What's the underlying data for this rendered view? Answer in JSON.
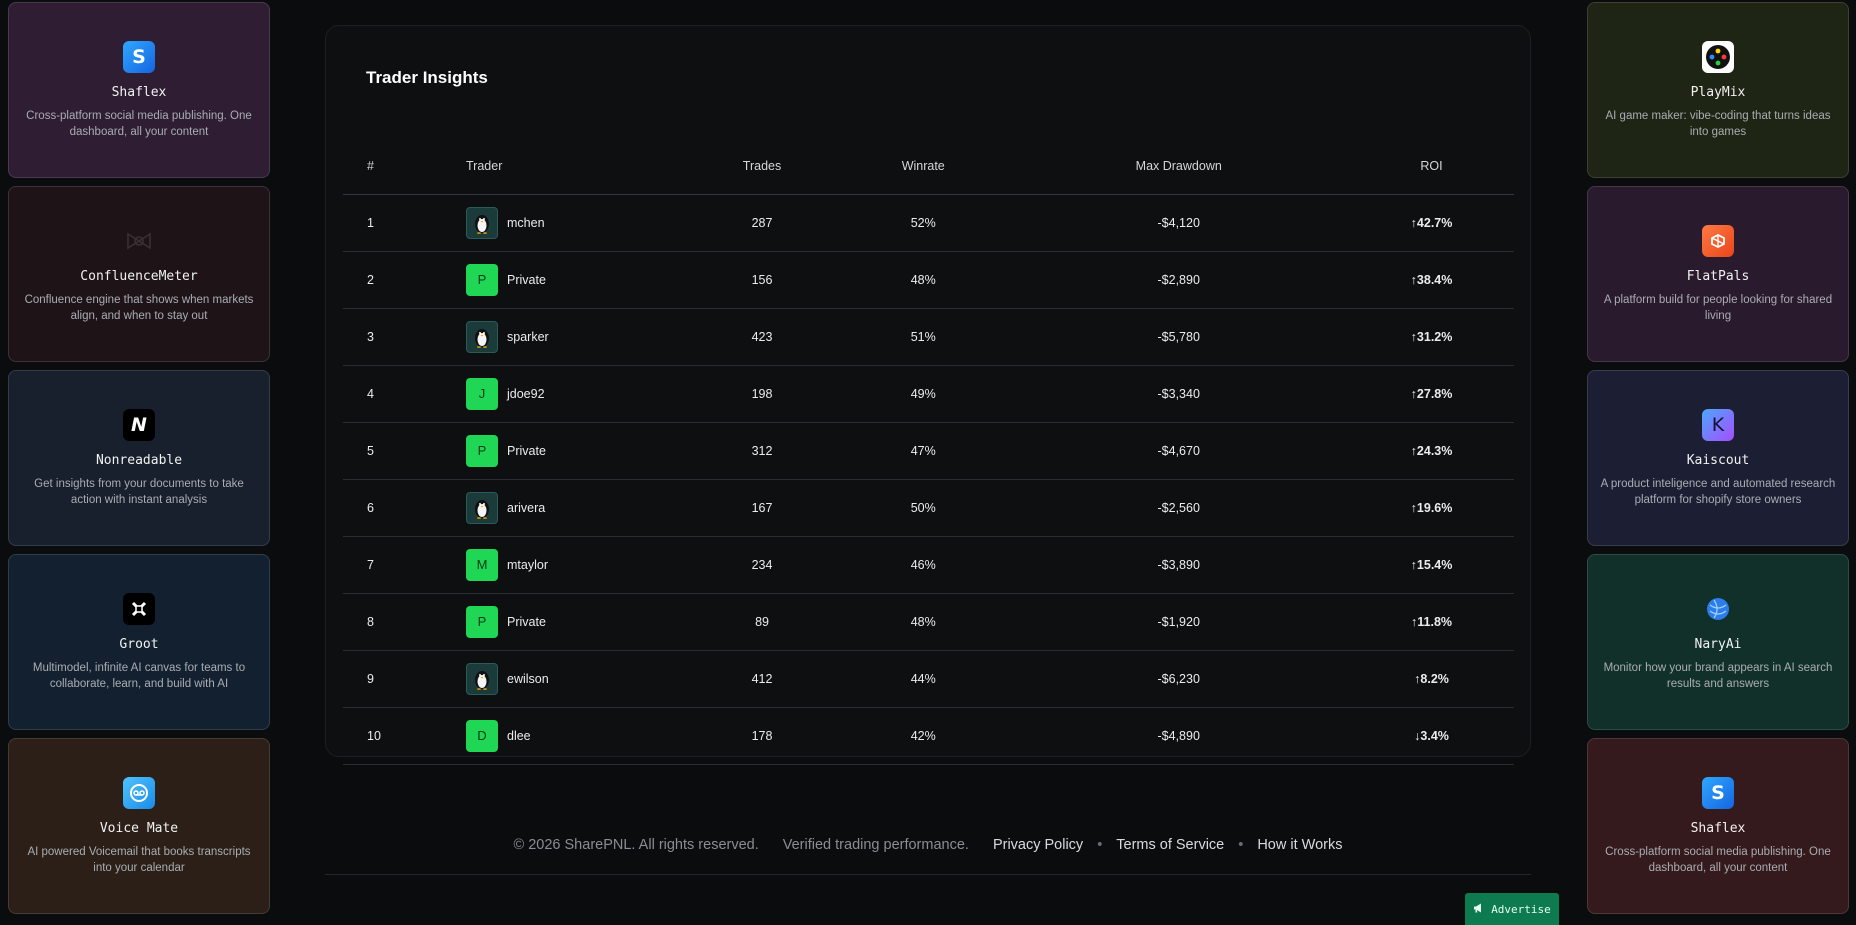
{
  "colors": {
    "accent_green": "#20d07a",
    "negative_red": "#ff4d4f",
    "avatar_green": "#1fd655",
    "advertise_bg": "#0d7a4f"
  },
  "left_ads": [
    {
      "name": "Shaflex",
      "desc": "Cross-platform social media publishing. One dashboard, all your content",
      "icon": "shaflex-logo-icon",
      "bg": "#2e1d33"
    },
    {
      "name": "ConfluenceMeter",
      "desc": "Confluence engine that shows when markets align, and when to stay out",
      "icon": "confluencemeter-logo-icon",
      "bg": "#1e1417"
    },
    {
      "name": "Nonreadable",
      "desc": "Get insights from your documents to take action with instant analysis",
      "icon": "nonreadable-logo-icon",
      "bg": "#17202c"
    },
    {
      "name": "Groot",
      "desc": "Multimodel, infinite AI canvas for teams to collaborate, learn, and build with AI",
      "icon": "groot-logo-icon",
      "bg": "#13202f"
    },
    {
      "name": "Voice Mate",
      "desc": "AI powered Voicemail that books transcripts into your calendar",
      "icon": "voicemate-logo-icon",
      "bg": "#2b1f17"
    }
  ],
  "right_ads": [
    {
      "name": "PlayMix",
      "desc": "AI game maker: vibe-coding that turns ideas into games",
      "icon": "playmix-logo-icon",
      "bg": "#1e2514"
    },
    {
      "name": "FlatPals",
      "desc": "A platform build for people looking for shared living",
      "icon": "flatpals-logo-icon",
      "bg": "#2a1a2d"
    },
    {
      "name": "Kaiscout",
      "desc": "A product inteligence and automated research platform for shopify store owners",
      "icon": "kaiscout-logo-icon",
      "bg": "#1c1f33"
    },
    {
      "name": "NaryAi",
      "desc": "Monitor how your brand appears in AI search results and answers",
      "icon": "naryai-logo-icon",
      "bg": "#12302a"
    },
    {
      "name": "Shaflex",
      "desc": "Cross-platform social media publishing. One dashboard, all your content",
      "icon": "shaflex-logo-icon",
      "bg": "#341a1d"
    }
  ],
  "insights": {
    "title": "Trader Insights",
    "columns": [
      "#",
      "Trader",
      "Trades",
      "Winrate",
      "Max Drawdown",
      "ROI"
    ],
    "rows": [
      {
        "rank": "1",
        "trader": "mchen",
        "avatar": "penguin",
        "trades": "287",
        "winrate": "52%",
        "drawdown": "-$4,120",
        "roi": "↑42.7%",
        "dir": "up"
      },
      {
        "rank": "2",
        "trader": "Private",
        "avatar": "P",
        "trades": "156",
        "winrate": "48%",
        "drawdown": "-$2,890",
        "roi": "↑38.4%",
        "dir": "up"
      },
      {
        "rank": "3",
        "trader": "sparker",
        "avatar": "penguin",
        "trades": "423",
        "winrate": "51%",
        "drawdown": "-$5,780",
        "roi": "↑31.2%",
        "dir": "up"
      },
      {
        "rank": "4",
        "trader": "jdoe92",
        "avatar": "J",
        "trades": "198",
        "winrate": "49%",
        "drawdown": "-$3,340",
        "roi": "↑27.8%",
        "dir": "up"
      },
      {
        "rank": "5",
        "trader": "Private",
        "avatar": "P",
        "trades": "312",
        "winrate": "47%",
        "drawdown": "-$4,670",
        "roi": "↑24.3%",
        "dir": "up"
      },
      {
        "rank": "6",
        "trader": "arivera",
        "avatar": "penguin",
        "trades": "167",
        "winrate": "50%",
        "drawdown": "-$2,560",
        "roi": "↑19.6%",
        "dir": "up"
      },
      {
        "rank": "7",
        "trader": "mtaylor",
        "avatar": "M",
        "trades": "234",
        "winrate": "46%",
        "drawdown": "-$3,890",
        "roi": "↑15.4%",
        "dir": "up"
      },
      {
        "rank": "8",
        "trader": "Private",
        "avatar": "P",
        "trades": "89",
        "winrate": "48%",
        "drawdown": "-$1,920",
        "roi": "↑11.8%",
        "dir": "up"
      },
      {
        "rank": "9",
        "trader": "ewilson",
        "avatar": "penguin",
        "trades": "412",
        "winrate": "44%",
        "drawdown": "-$6,230",
        "roi": "↑8.2%",
        "dir": "up"
      },
      {
        "rank": "10",
        "trader": "dlee",
        "avatar": "D",
        "trades": "178",
        "winrate": "42%",
        "drawdown": "-$4,890",
        "roi": "↓3.4%",
        "dir": "down"
      }
    ]
  },
  "footer": {
    "copyright": "© 2026 SharePNL. All rights reserved.",
    "tagline": "Verified trading performance.",
    "privacy": "Privacy Policy",
    "separator": "•",
    "terms": "Terms of Service",
    "how": "How it Works"
  },
  "advertise": {
    "label": "Advertise",
    "icon": "megaphone-icon"
  }
}
